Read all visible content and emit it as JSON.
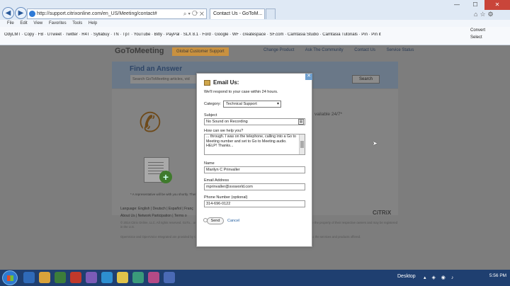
{
  "browser": {
    "address": "http://support.citrixonline.com/en_US/Meeting/contact#",
    "tab_label": "Contact Us - GoToM...",
    "tools_glyphs": "⌕ ▾ ⟳ ✕",
    "menu": [
      "File",
      "Edit",
      "View",
      "Favorites",
      "Tools",
      "Help"
    ],
    "favorites": [
      "OdyLMT",
      "Copy",
      "FB",
      "UTweet",
      "Twitter",
      "R4T",
      "Syllabuy",
      "TN",
      "TpT",
      "YouTube",
      "Bitly",
      "PayPal",
      "SLX 8.1",
      "Ford",
      "Google",
      "WF",
      "createspace",
      "SF.com",
      "Camtasia Studio",
      "Camtasia Tutorials",
      "Pin",
      "Pin it"
    ],
    "fav_tools": [
      "Convert",
      "Select"
    ]
  },
  "site": {
    "logo": "GoToMeeting",
    "badge": "Global Customer Support",
    "nav": [
      "Change Product",
      "Ask The Community",
      "Contact Us",
      "Service Status"
    ],
    "find_title": "Find an Answer",
    "search_placeholder": "Search GoToMeeting articles, vid",
    "search_button": "Search",
    "avail": "vailable 24/7*",
    "footnote": "* A representative will be with you shortly. There",
    "lang_line": "Language: English | Deutsch | Español | Franç",
    "foot_links": "About Us | Network Participation | Terms o",
    "citrix": "CiTRiX",
    "legal1": "© 2014 Citrix Online, LLC. All rights reserved. GoTo... and Citrix Systems, Inc. in the United States and/or other countries. Other trademarks are the property of their respective owners and may be registered in the U.S.",
    "legal2": "OpenVoice and OpenVoice Integrated are provided by Citrix Online, LLC in the applicable jurisdictions. The terms and conditions of use apply to the services and products offered."
  },
  "modal": {
    "title": "Email Us:",
    "subtitle": "We'll respond to your case within 24 hours.",
    "category_label": "Category:",
    "category_value": "Technical Support",
    "subject_label": "Subject",
    "subject_value": "No Sound on Recording",
    "message_label": "How can we help you?",
    "message_value": "... through. I was on the telephone, calling into a Go to Meeting number and set to Go to Meeting audio. HELP! Thanks...",
    "name_label": "Name",
    "name_value": "Marilyn C Prinvaller",
    "email_label": "Email Address",
    "email_value": "mprinvaller@svsworld.com",
    "phone_label": "Phone Number (optional)",
    "phone_value": "314-696-0122",
    "send_label": "Send",
    "cancel_label": "Cancel"
  },
  "taskbar": {
    "desktop": "Desktop",
    "clock": "5:56 PM"
  }
}
